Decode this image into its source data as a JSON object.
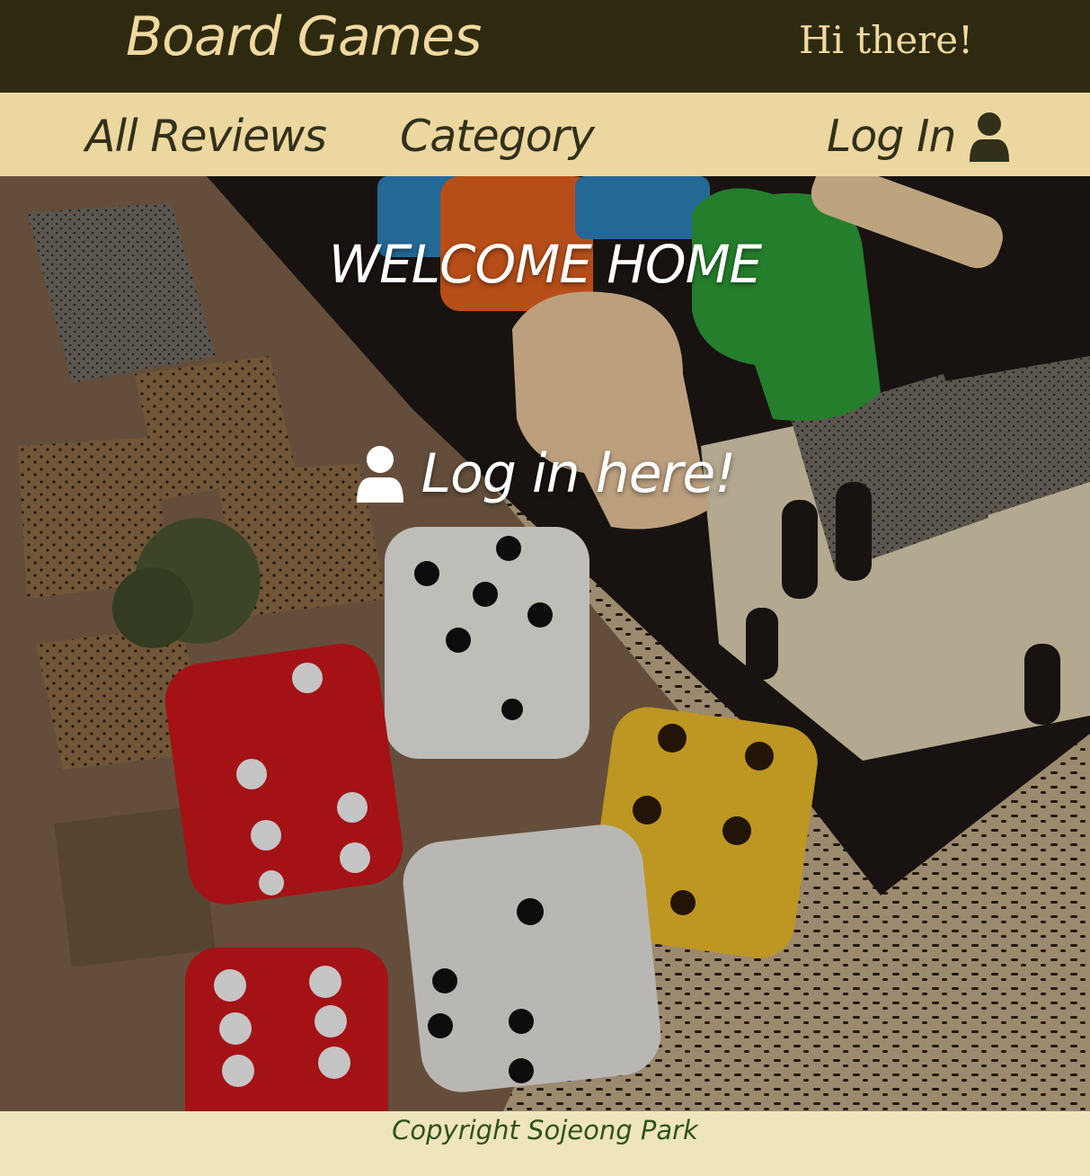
{
  "header": {
    "brand": "Board Games",
    "greeting": "Hi there!"
  },
  "nav": {
    "all_reviews": "All Reviews",
    "category": "Category",
    "login": "Log In",
    "login_icon": "user-icon"
  },
  "hero": {
    "title": "WELCOME HOME",
    "login_link": "Log in here!",
    "login_icon": "user-icon"
  },
  "footer": {
    "copyright": "Copyright Sojeong Park"
  },
  "colors": {
    "header_bg": "#2e2a10",
    "header_text": "#f0d9a0",
    "nav_bg": "#ecd7a1",
    "nav_text": "#33301a",
    "footer_bg": "#efe5bd",
    "footer_text": "#2f5218"
  }
}
